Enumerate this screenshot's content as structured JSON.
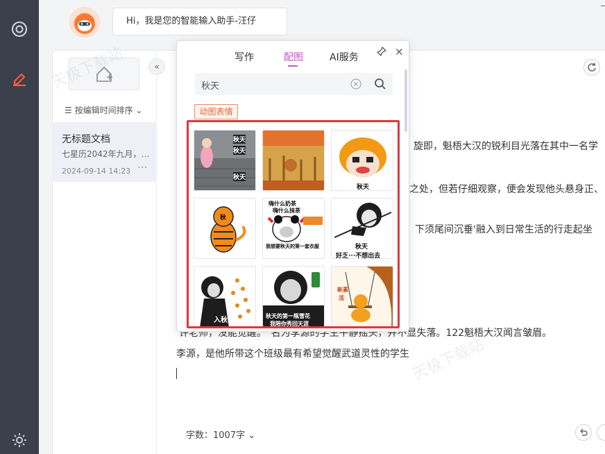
{
  "assistant": {
    "greeting": "Hi，我是您的智能输入助手-汪仔"
  },
  "doclist": {
    "sort_label": "按编辑时间排序",
    "items": [
      {
        "title": "无标题文档",
        "snippet": "七星历2042年九月，…",
        "date": "2024-09-14 14:23",
        "more": "···"
      }
    ]
  },
  "editor": {
    "lines": [
      "旋即，魁梧大汉的锐利目光落在其中一名学",
      "之处，但若仔细观察，便会发现他头悬身正、",
      "下须尾间沉垂'融入到日常生活的行走起坐",
      "许老师，没能觉醒。\"名为李源的学生平静摇头，并不显失落。122魁梧大汉闻言皱眉。",
      "李源，是他所带这个班级最有希望觉醒武道灵性的学生"
    ],
    "word_count": "字数：1007字"
  },
  "popup": {
    "tabs": [
      {
        "label": "写作",
        "active": false
      },
      {
        "label": "配图",
        "active": true
      },
      {
        "label": "AI服务",
        "active": false
      }
    ],
    "search_value": "秋天",
    "category": "动图表情",
    "stickers": [
      {
        "name": "girl-scene",
        "captions": [
          "秋天",
          "秋天",
          "秋天"
        ]
      },
      {
        "name": "autumn-scene",
        "captions": []
      },
      {
        "name": "orange-hair",
        "captions": [
          "秋天"
        ]
      },
      {
        "name": "tiger",
        "captions": [
          "秋"
        ]
      },
      {
        "name": "panda-bow",
        "captions": [
          "嗨什么奶茶",
          "嗨什么抹茶",
          "我想要秋天的第一套衣服"
        ]
      },
      {
        "name": "panda-line",
        "captions": [
          "秋天",
          "好乏···不想出去"
        ]
      },
      {
        "name": "panda-leaves",
        "captions": [
          "入秋了"
        ]
      },
      {
        "name": "panda-drink",
        "captions": [
          "秋天的第一瓶雪花",
          "我陪你秀回天涯"
        ]
      },
      {
        "name": "swing",
        "captions": [
          "新素",
          "活"
        ]
      }
    ]
  },
  "watermark": "天极下载站",
  "colors": {
    "rail": "#3a3f4b",
    "accent": "#c452c8",
    "highlight": "#e0363c",
    "tag": "#e7683a"
  }
}
